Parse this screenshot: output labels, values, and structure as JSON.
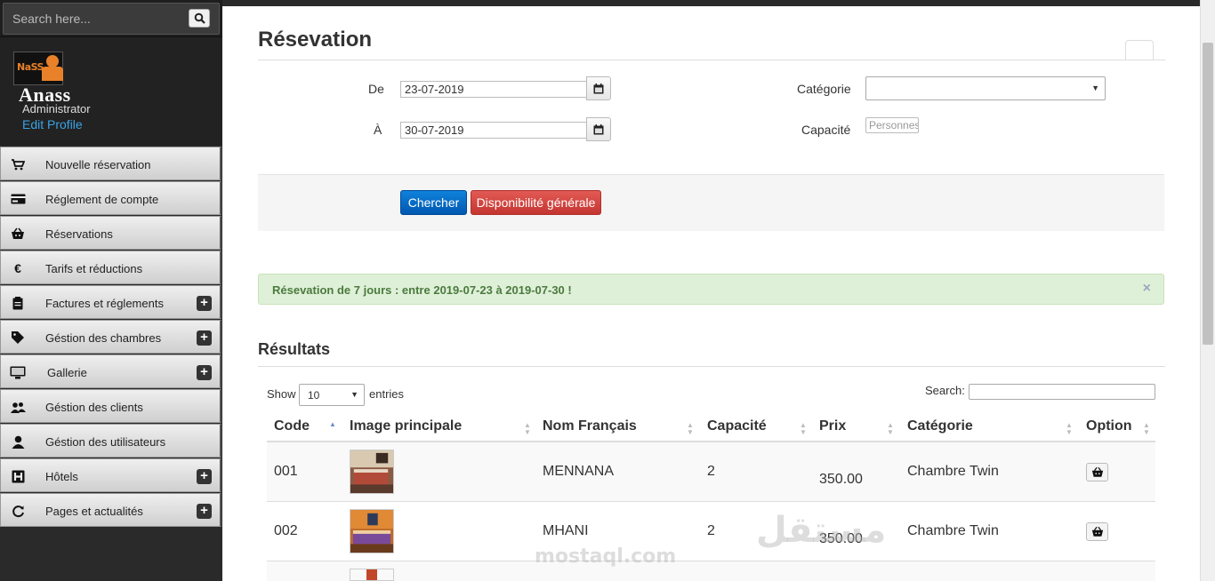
{
  "sidebar": {
    "search": {
      "placeholder": "Search here..."
    },
    "profile": {
      "logo_text": "NaSS",
      "name": "Anass",
      "role": "Administrator",
      "edit_link": "Edit Profile"
    },
    "items": [
      {
        "label": "Nouvelle réservation",
        "icon": "cart-icon",
        "expandable": false
      },
      {
        "label": "Réglement de compte",
        "icon": "credit-card-icon",
        "expandable": false
      },
      {
        "label": "Réservations",
        "icon": "basket-icon",
        "expandable": false
      },
      {
        "label": "Tarifs et réductions",
        "icon": "euro-icon",
        "expandable": false
      },
      {
        "label": "Factures et réglements",
        "icon": "invoice-icon",
        "expandable": true
      },
      {
        "label": "Géstion des chambres",
        "icon": "tag-icon",
        "expandable": true
      },
      {
        "label": "Gallerie",
        "icon": "monitor-icon",
        "expandable": true
      },
      {
        "label": "Géstion des clients",
        "icon": "users-icon",
        "expandable": false
      },
      {
        "label": "Géstion des utilisateurs",
        "icon": "user-icon",
        "expandable": false
      },
      {
        "label": "Hôtels",
        "icon": "hotel-icon",
        "expandable": true
      },
      {
        "label": "Pages et actualités",
        "icon": "refresh-icon",
        "expandable": true
      }
    ],
    "plus_symbol": "+"
  },
  "main": {
    "title": "Résevation",
    "form": {
      "from_label": "De",
      "from_value": "23-07-2019",
      "to_label": "À",
      "to_value": "30-07-2019",
      "category_label": "Catégorie",
      "category_value": "",
      "capacity_label": "Capacité",
      "capacity_placeholder": "Personnes"
    },
    "actions": {
      "search_button": "Chercher",
      "availability_button": "Disponibilité générale"
    },
    "alert": {
      "text": "Résevation de 7 jours : entre 2019-07-23 à 2019-07-30 !",
      "close": "×",
      "color": "#dff0d8"
    },
    "results": {
      "title": "Résultats",
      "show_label": "Show",
      "entries_value": "10",
      "entries_label": "entries",
      "search_label": "Search:",
      "columns": [
        "Code",
        "Image principale",
        "Nom Français",
        "Capacité",
        "Prix",
        "Catégorie",
        "Option"
      ],
      "rows": [
        {
          "code": "001",
          "name": "MENNANA",
          "capacity": "2",
          "price": "350.00",
          "category": "Chambre Twin",
          "option_icon": "basket-icon"
        },
        {
          "code": "002",
          "name": "MHANI",
          "capacity": "2",
          "price": "350.00",
          "category": "Chambre Twin",
          "option_icon": "basket-icon"
        }
      ]
    },
    "watermark": {
      "arabic": "مستقل",
      "latin": "mostaql.com"
    }
  },
  "colors": {
    "primary": "#0069c6",
    "danger": "#d9534f",
    "link": "#39a3e6",
    "sidebar_bg": "#2a2a2a"
  }
}
